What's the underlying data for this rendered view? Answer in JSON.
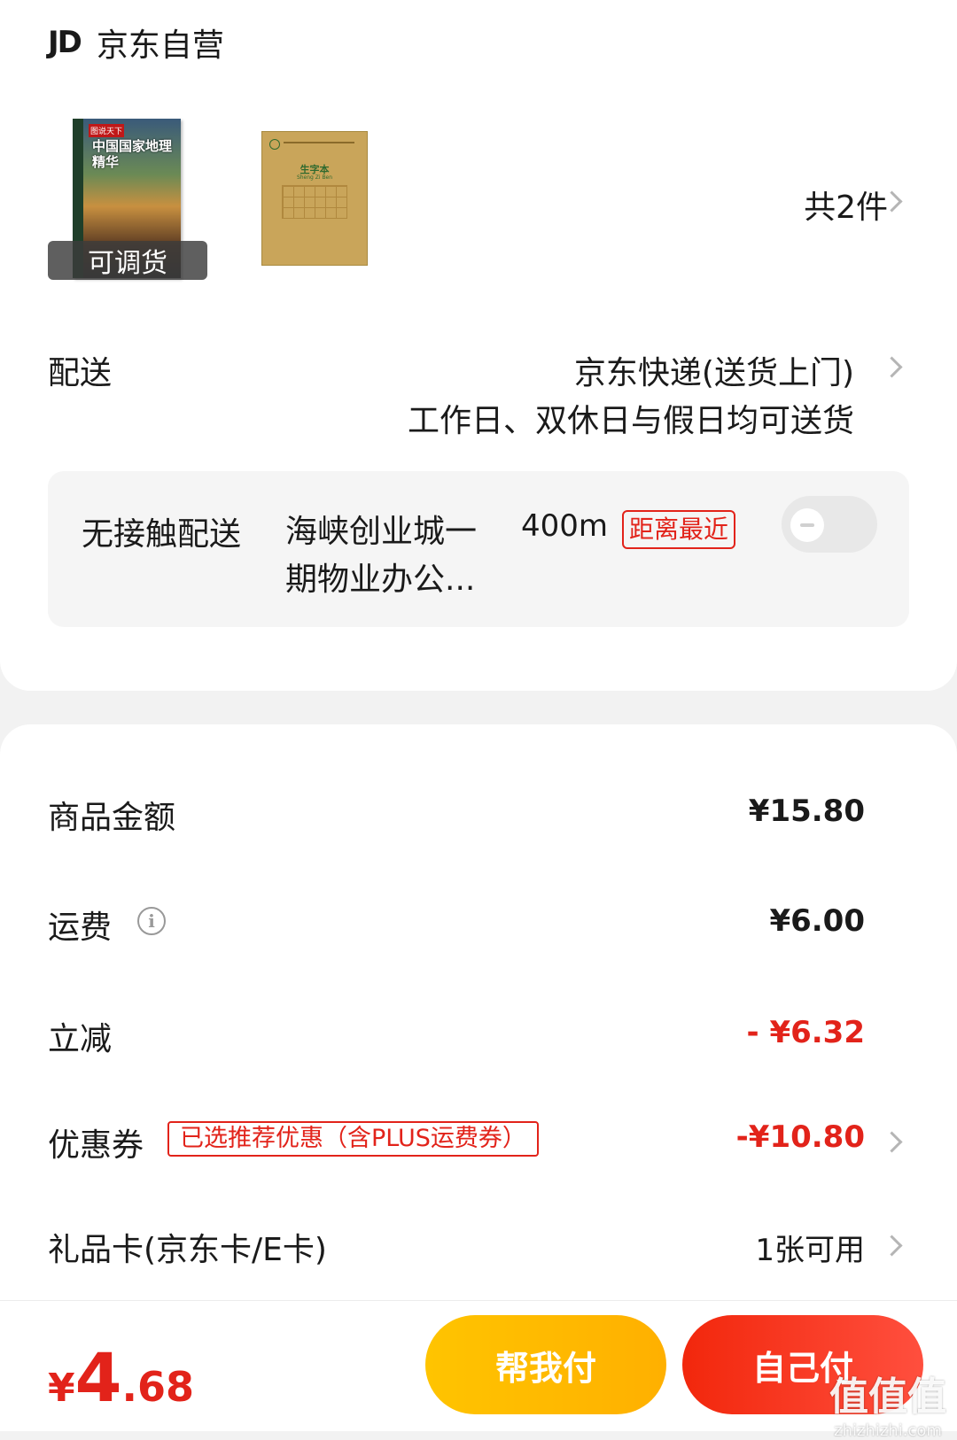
{
  "shop": {
    "logo_text": "JD",
    "name": "京东自营"
  },
  "products": {
    "item1": {
      "badge": "可调货",
      "cover_title": "中国国家地理精华",
      "cover_tag": "图说天下"
    },
    "item2": {
      "cover_title": "生字本",
      "cover_sub": "Sheng Zi Ben"
    },
    "count_text": "共2件"
  },
  "delivery": {
    "label": "配送",
    "method": "京东快递(送货上门)",
    "schedule": "工作日、双休日与假日均可送货"
  },
  "contactless": {
    "label": "无接触配送",
    "address": "海峡创业城一期物业办公...",
    "distance": "400m",
    "tag": "距离最近",
    "enabled": false
  },
  "price_rows": {
    "goods_label": "商品金额",
    "goods_value": "¥15.80",
    "shipping_label": "运费",
    "shipping_value": "¥6.00",
    "discount_label": "立减",
    "discount_value": "- ¥6.32",
    "coupon_label": "优惠券",
    "coupon_tag": "已选推荐优惠（含PLUS运费券）",
    "coupon_value": "-¥10.80",
    "giftcard_label": "礼品卡(京东卡/E卡)",
    "giftcard_value": "1张可用"
  },
  "bottom": {
    "total_symbol": "¥",
    "total_int": "4",
    "total_dec": ".68",
    "help_pay_label": "帮我付",
    "self_pay_label": "自己付"
  },
  "watermark": {
    "logo": "值值值",
    "url": "zhizhizhi.com"
  },
  "colors": {
    "accent_red": "#e2231a",
    "help_btn": "#ffc400",
    "self_btn": "#f2270c"
  }
}
